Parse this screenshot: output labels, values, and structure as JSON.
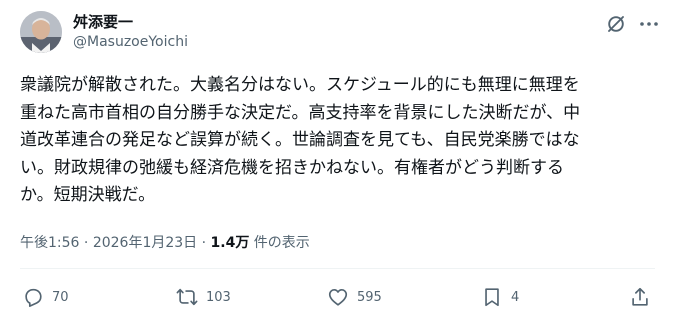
{
  "author": {
    "name": "舛添要一",
    "handle": "@MasuzoeYoichi",
    "avatar_icon": "profile-photo-avatar"
  },
  "header_icons": [
    "grok-icon",
    "more-options-icon"
  ],
  "post": {
    "lines": [
      "衆議院が解散された。大義名分はない。スケジュール的にも無理に無理を",
      "重ねた高市首相の自分勝手な決定だ。高支持率を背景にした決断だが、中",
      "道改革連合の発足など誤算が続く。世論調査を見ても、自民党楽勝ではな",
      "い。財政規律の弛緩も経済危機を招きかねない。有権者がどう判断する",
      "か。短期決戦だ。"
    ]
  },
  "meta": {
    "time": "午後1:56",
    "separator": "·",
    "date": "2026年1月23日",
    "views": "1.4万",
    "views_suffix": "件の表示"
  },
  "actions": {
    "reply": {
      "icon": "reply-icon",
      "count": "70"
    },
    "repost": {
      "icon": "repost-icon",
      "count": "103"
    },
    "like": {
      "icon": "heart-icon",
      "count": "595"
    },
    "bookmark": {
      "icon": "bookmark-icon",
      "count": "4"
    },
    "share": {
      "icon": "share-icon"
    }
  },
  "colors": {
    "text": "#0f1419",
    "secondary": "#536471",
    "divider": "#eff3f4"
  }
}
